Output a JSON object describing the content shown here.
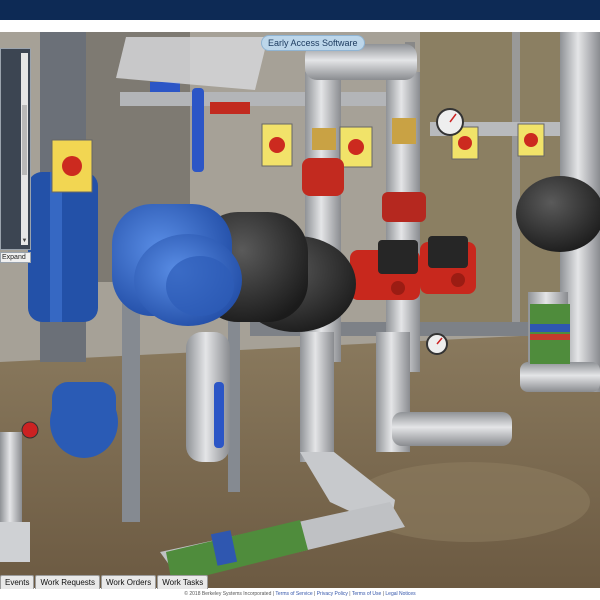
{
  "app": {
    "badge_label": "Early Access Software"
  },
  "side_panel": {
    "expand_label": "Expand"
  },
  "tabs": [
    {
      "label": "Events"
    },
    {
      "label": "Work Requests"
    },
    {
      "label": "Work Orders"
    },
    {
      "label": "Work Tasks"
    }
  ],
  "footer": {
    "copyright": "© 2018 Berkeley Systems Incorporated",
    "sep": "|",
    "links": [
      "Terms of Service",
      "Privacy Policy",
      "Terms of Use",
      "Legal Notices"
    ]
  },
  "colors": {
    "header": "#0d2a55",
    "pump_blue": "#2f64c4",
    "motor_black": "#2a2a2a",
    "valve_red": "#c82a1f",
    "pipe_silver": "#c4c6c9",
    "pipe_green_label": "#4e8a3c"
  },
  "icons": [
    "pressure-gauge-icon",
    "isolator-switch-icon",
    "scroll-up-icon",
    "scroll-down-icon"
  ]
}
